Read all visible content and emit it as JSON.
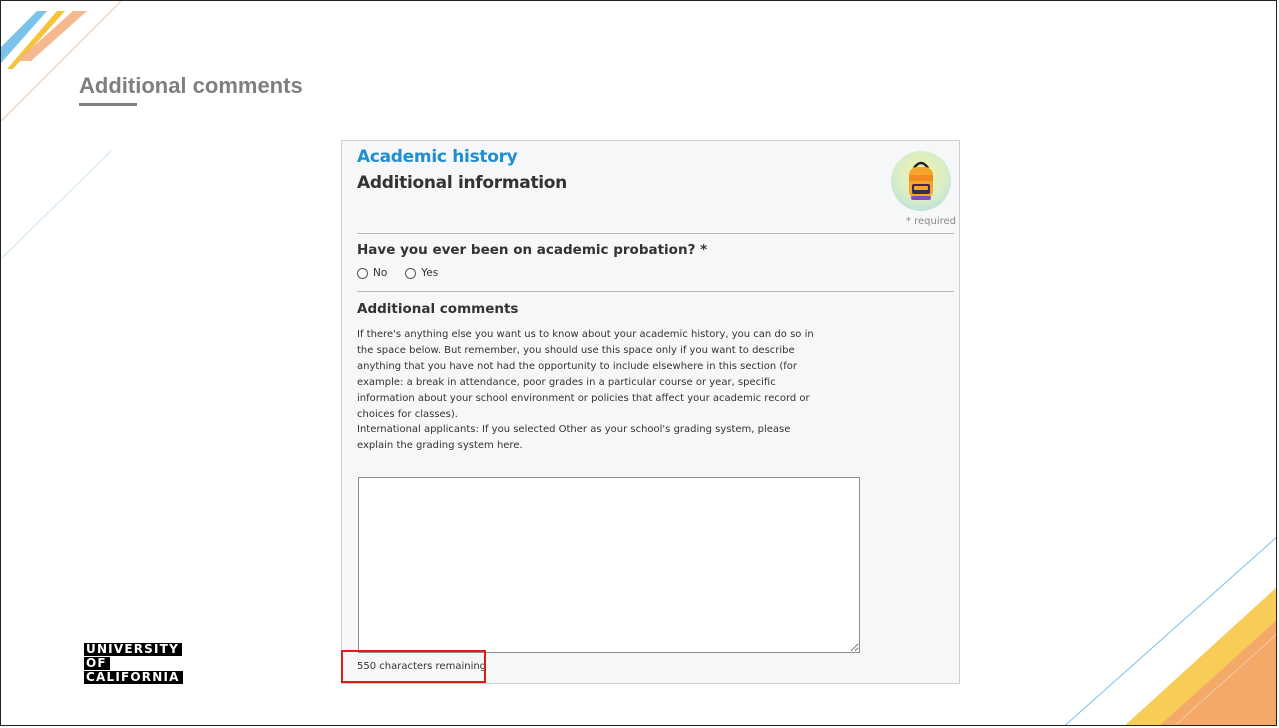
{
  "slide": {
    "title": "Additional comments",
    "logo": [
      "UNIVERSITY",
      "OF",
      "CALIFORNIA"
    ]
  },
  "form": {
    "section_title": "Academic history",
    "section_subtitle": "Additional information",
    "badge_icon": "backpack-icon",
    "required_note": "* required",
    "probation_question": "Have you ever been on academic probation? *",
    "radio_options": [
      "No",
      "Yes"
    ],
    "comments_heading": "Additional comments",
    "instructions_1": "If there's anything else you want us to know about your academic history, you can do so in the space below. But remember, you should use this space only if you want to describe anything that you have not had the opportunity to include elsewhere in this section (for example: a break in attendance, poor grades in a particular course or year, specific information about your school environment or policies that affect your academic record or choices for classes).",
    "instructions_2": "International applicants: If you selected Other as your school's grading system, please explain the grading system here.",
    "comments_value": "",
    "characters_remaining": "550 characters remaining"
  },
  "colors": {
    "section_title": "#1f8fd4",
    "highlight": "#e01b1b",
    "slide_title": "#7f7f7f"
  }
}
